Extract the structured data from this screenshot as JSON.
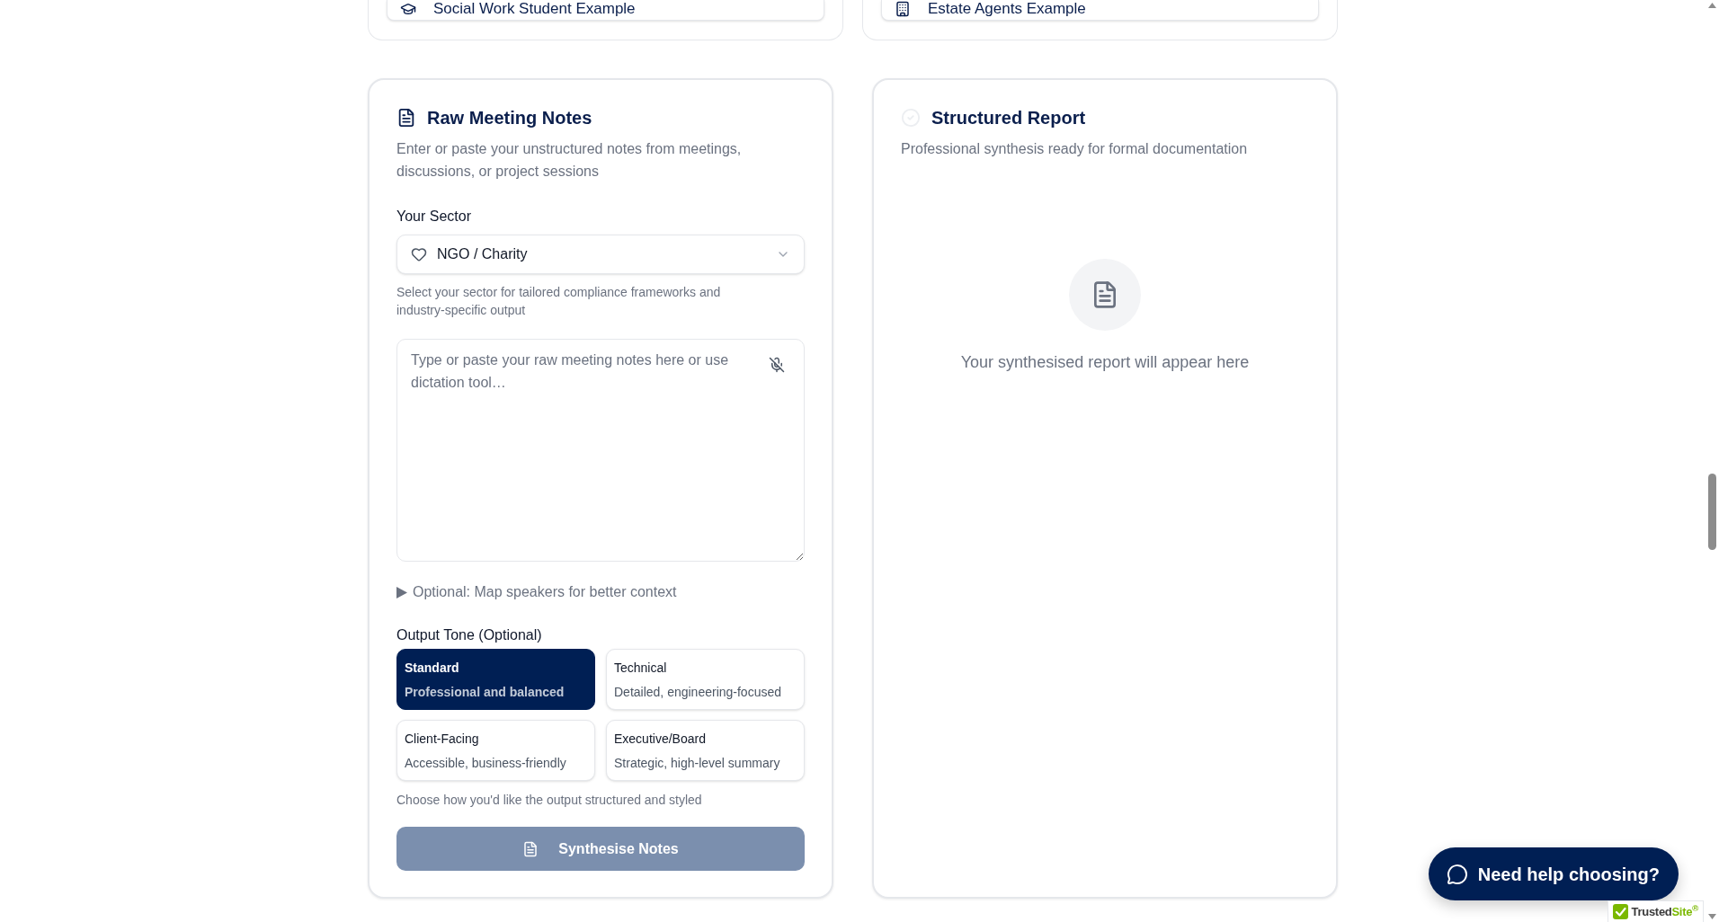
{
  "example_cards": [
    {
      "label": "Social Work Student Example"
    },
    {
      "label": "Estate Agents Example"
    }
  ],
  "notes_panel": {
    "title": "Raw Meeting Notes",
    "description": "Enter or paste your unstructured notes from meetings, discussions, or project sessions",
    "sector_label": "Your Sector",
    "sector_select": {
      "value": "NGO / Charity"
    },
    "sector_hint": "Select your sector for tailored compliance frameworks and industry-specific output",
    "notes_field": {
      "placeholder": "Type or paste your raw meeting notes here or use dictation tool…"
    },
    "speaker_mapping": {
      "label": "Optional: Map speakers for better context",
      "expanded": false
    },
    "tone_label": "Output Tone (Optional)",
    "tone_options": [
      {
        "title": "Standard",
        "description": "Professional and balanced",
        "selected": true
      },
      {
        "title": "Technical",
        "description": "Detailed, engineering-focused",
        "selected": false
      },
      {
        "title": "Client-Facing",
        "description": "Accessible, business-friendly",
        "selected": false
      },
      {
        "title": "Executive/Board",
        "description": "Strategic, high-level summary",
        "selected": false
      }
    ],
    "tone_hint": "Choose how you'd like the output structured and styled",
    "submit_button": {
      "label": "Synthesise Notes",
      "disabled": true
    }
  },
  "report_panel": {
    "title": "Structured Report",
    "ready": false,
    "description": "Professional synthesis ready for formal documentation",
    "empty_message": "Your synthesised report will appear here"
  },
  "help_button": {
    "label": "Need help choosing?"
  },
  "trust_badge": {
    "text_1": "Trusted",
    "text_2": "Site$^{®}$"
  }
}
